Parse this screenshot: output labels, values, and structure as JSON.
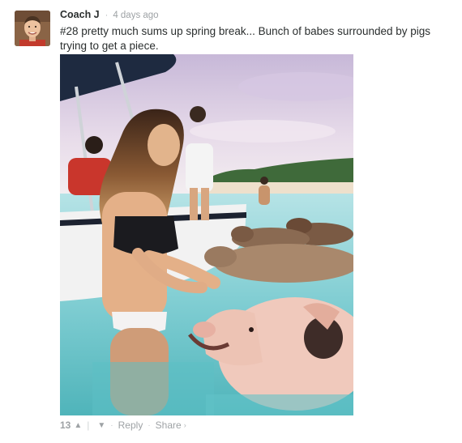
{
  "comment": {
    "author": "Coach J",
    "separator": "·",
    "timestamp": "4 days ago",
    "message": "#28 pretty much sums up spring break... Bunch of babes surrounded by pigs trying to get a piece.",
    "photo_icon": "beach-photo-image",
    "footer": {
      "upvote_count": "13",
      "upvote_icon": "▲",
      "downvote_icon": "▼",
      "bar": "|",
      "dot": "·",
      "reply_label": "Reply",
      "share_label": "Share",
      "share_chevron": "›"
    }
  },
  "colors": {
    "text": "#2a2e2e",
    "muted": "#9ea2a5",
    "background": "#ffffff"
  }
}
